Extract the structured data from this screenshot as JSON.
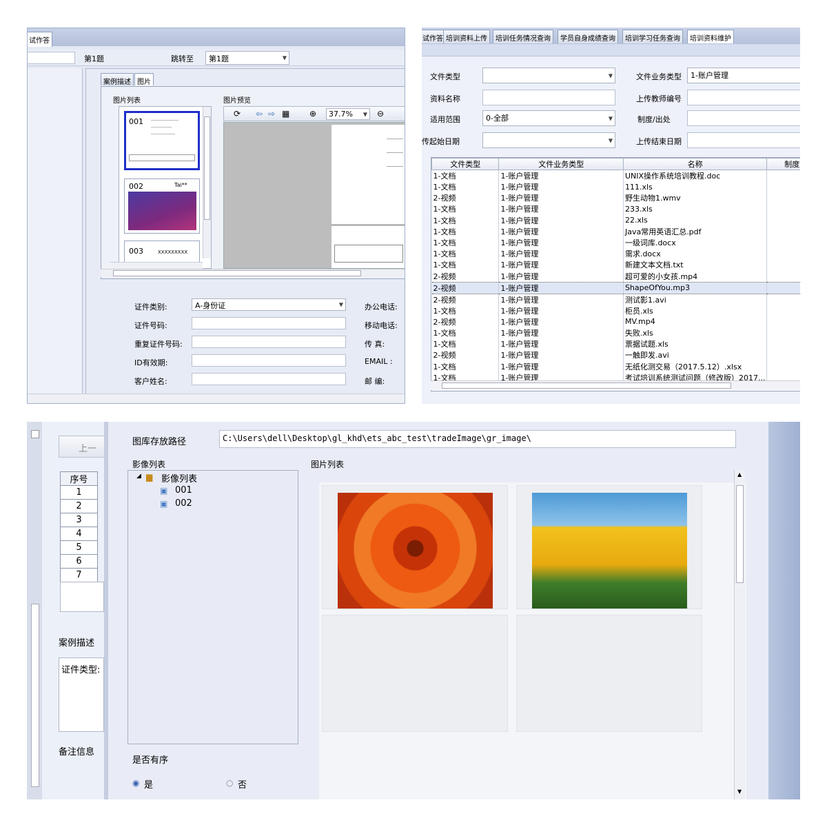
{
  "pane1": {
    "tab_label": "试作答",
    "question_label": "第1题",
    "jump_label": "跳转至",
    "jump_value": "第1题",
    "inner_tabs": [
      "案例描述",
      "图片"
    ],
    "list_title": "图片列表",
    "preview_title": "图片预览",
    "thumbs": [
      "001",
      "002",
      "003"
    ],
    "thumb2_logo": "Tai**",
    "thumb3_text": "XXXXXXXXX",
    "zoom": "37.7%",
    "form": {
      "id_type_label": "证件类别:",
      "id_type_value": "A-身份证",
      "id_no_label": "证件号码:",
      "id_repeat_label": "重复证件号码:",
      "id_valid_label": "ID有效期:",
      "customer_label": "客户姓名:",
      "office_phone_label": "办公电话:",
      "mobile_label": "移动电话:",
      "fax_label": "传 真:",
      "email_label": "EMAIL :",
      "post_label": "邮 编:"
    }
  },
  "pane2": {
    "tabs": [
      "试作答",
      "培训资料上传",
      "培训任务情况查询",
      "学员自身成绩查询",
      "培训学习任务查询",
      "培训资料维护"
    ],
    "file_type_label": "文件类型",
    "biz_type_label": "文件业务类型",
    "biz_type_value": "1-账户管理",
    "name_label": "资料名称",
    "teacher_label": "上传教师编号",
    "scope_label": "适用范围",
    "scope_value": "0-全部",
    "origin_label": "制度/出处",
    "start_label": "传起始日期",
    "end_label": "上传结束日期",
    "columns": [
      "文件类型",
      "文件业务类型",
      "名称",
      "制度"
    ],
    "rows": [
      [
        "1-文档",
        "1-账户管理",
        "UNIX操作系统培训教程.doc"
      ],
      [
        "1-文档",
        "1-账户管理",
        "111.xls"
      ],
      [
        "2-视频",
        "1-账户管理",
        "野生动物1.wmv"
      ],
      [
        "1-文档",
        "1-账户管理",
        "233.xls"
      ],
      [
        "1-文档",
        "1-账户管理",
        "22.xls"
      ],
      [
        "1-文档",
        "1-账户管理",
        "Java常用英语汇总.pdf"
      ],
      [
        "1-文档",
        "1-账户管理",
        "一级词库.docx"
      ],
      [
        "1-文档",
        "1-账户管理",
        "需求.docx"
      ],
      [
        "1-文档",
        "1-账户管理",
        "新建文本文档.txt"
      ],
      [
        "2-视频",
        "1-账户管理",
        "超可爱的小女孩.mp4"
      ],
      [
        "2-视频",
        "1-账户管理",
        "ShapeOfYou.mp3"
      ],
      [
        "2-视频",
        "1-账户管理",
        "测试影1.avi"
      ],
      [
        "1-文档",
        "1-账户管理",
        "柜员.xls"
      ],
      [
        "2-视频",
        "1-账户管理",
        "MV.mp4"
      ],
      [
        "1-文档",
        "1-账户管理",
        "失败.xls"
      ],
      [
        "1-文档",
        "1-账户管理",
        "票据试题.xls"
      ],
      [
        "2-视频",
        "1-账户管理",
        "一触即发.avi"
      ],
      [
        "1-文档",
        "1-账户管理",
        "无纸化测交易（2017.5.12）.xlsx"
      ],
      [
        "1-文档",
        "1-账户管理",
        "考试培训系统测试问题（修改版）2017..."
      ]
    ],
    "selected_row": 10
  },
  "pane3": {
    "path_label": "图库存放路径",
    "path_value": "C:\\Users\\dell\\Desktop\\gl_khd\\ets_abc_test\\tradeImage\\gr_image\\",
    "image_list_label": "影像列表",
    "tree_root": "影像列表",
    "tree_items": [
      "001",
      "002"
    ],
    "pic_list_label": "图片列表",
    "prev_button": "上一",
    "seq_header": "序号",
    "seq": [
      "1",
      "2",
      "3",
      "4",
      "5",
      "6",
      "7"
    ],
    "case_desc_label": "案例描述",
    "id_type_stub": "证件类型:",
    "remark_label": "备注信息",
    "ordered_label": "是否有序",
    "yes": "是",
    "no": "否"
  },
  "colors": {
    "accent": "#1d2fc9",
    "selection": "#dfe6f6"
  }
}
